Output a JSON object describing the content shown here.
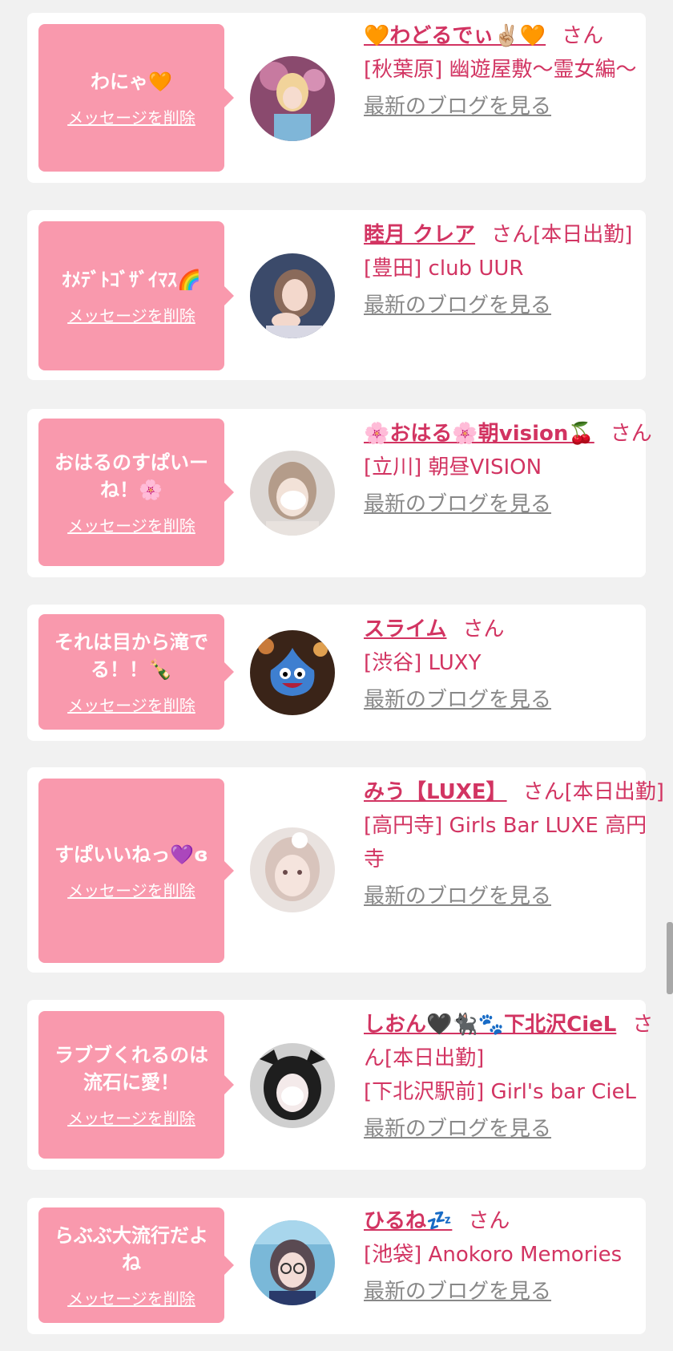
{
  "delete_label": "メッセージを削除",
  "blog_label": "最新のブログを見る",
  "san_label": "さん",
  "accent_color": "#d23462",
  "bubble_color": "#f999ad",
  "cards": [
    {
      "message": "わにゃ🧡",
      "name": "🧡わどるでぃ✌🏼🧡",
      "suffix": "",
      "shop": "[秋葉原] 幽遊屋敷〜霊女編〜"
    },
    {
      "message": "ｵﾒﾃﾞﾄｺﾞｻﾞｲﾏｽ🌈",
      "name": "睦月 クレア",
      "suffix": "[本日出勤]",
      "shop": "[豊田] club UUR"
    },
    {
      "message": "おはるのすぱいーね！🌸",
      "name": "🌸おはる🌸朝vision🍒",
      "suffix": "",
      "shop": "[立川] 朝昼VISION"
    },
    {
      "message": "それは目から滝でる！！🍾",
      "name": "スライム",
      "suffix": "",
      "shop": "[渋谷] LUXY"
    },
    {
      "message": "すぱいいねっ💜ɞ",
      "name": "みう【LUXE】",
      "suffix": "[本日出勤]",
      "shop": "[高円寺] Girls Bar LUXE 高円寺"
    },
    {
      "message": "ラブブくれるのは流石に愛！",
      "name": "しおん🖤🐈‍⬛🐾下北沢CieL",
      "suffix": "[本日出勤]",
      "shop": "[下北沢駅前] Girl's bar CieL"
    },
    {
      "message": "らぶぶ大流行だよね",
      "name": "ひるね💤",
      "suffix": "",
      "shop": "[池袋] Anokoro Memories"
    }
  ]
}
